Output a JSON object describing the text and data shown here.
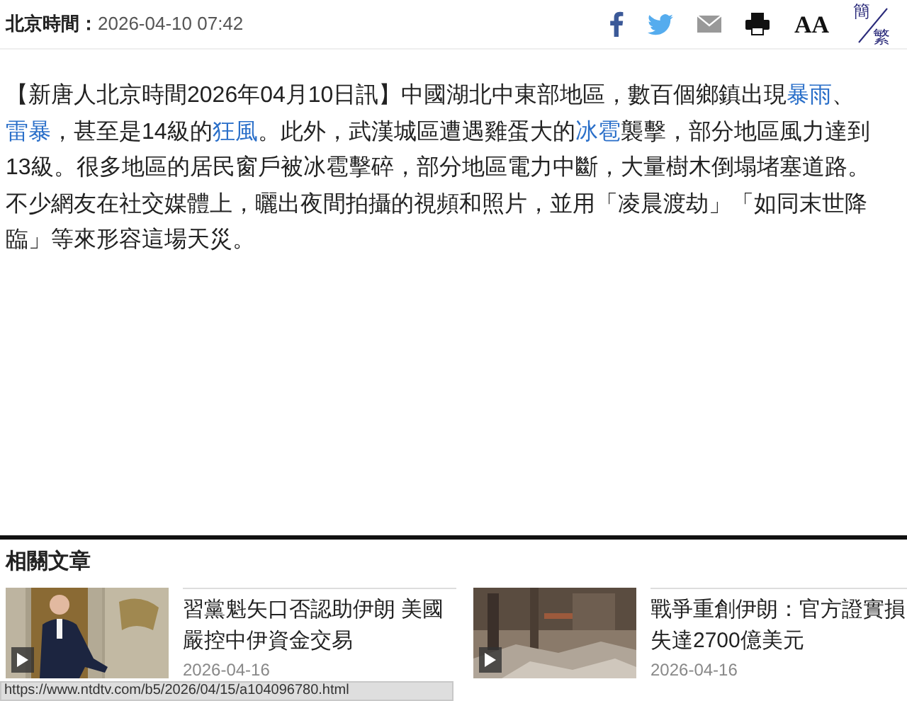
{
  "header": {
    "label": "北京時間：",
    "datetime": "2026-04-10 07:42",
    "font_size_button": "AA",
    "lang_toggle": {
      "top": "簡",
      "bottom": "繁"
    }
  },
  "article": {
    "segments": [
      {
        "text": "【新唐人北京時間2026年04月10日訊】中國湖北中東部地區，數百個鄉鎮出現",
        "link": false
      },
      {
        "text": "暴雨",
        "link": true
      },
      {
        "text": "、",
        "link": false
      },
      {
        "text": "雷暴",
        "link": true
      },
      {
        "text": "，甚至是14級的",
        "link": false
      },
      {
        "text": "狂風",
        "link": true
      },
      {
        "text": "。此外，武漢城區遭遇雞蛋大的",
        "link": false
      },
      {
        "text": "冰雹",
        "link": true
      },
      {
        "text": "襲擊，部分地區風力達到13級。很多地區的居民窗戶被冰雹擊碎，部分地區電力中斷，大量樹木倒塌堵塞道路。不少網友在社交媒體上，曬出夜間拍攝的視頻和照片，並用「凌晨渡劫」「如同末世降臨」等來形容這場天災。",
        "link": false
      }
    ]
  },
  "related": {
    "title": "相關文章",
    "items": [
      {
        "title": "習黨魁矢口否認助伊朗  美國嚴控中伊資金交易",
        "date": "2026-04-16",
        "kind": "picture"
      },
      {
        "title": "戰爭重創伊朗：官方證實損失達2700億美元",
        "date": "2026-04-16",
        "kind": "picture"
      }
    ]
  },
  "status_bar": {
    "url": "https://www.ntdtv.com/b5/2026/04/15/a104096780.html"
  }
}
